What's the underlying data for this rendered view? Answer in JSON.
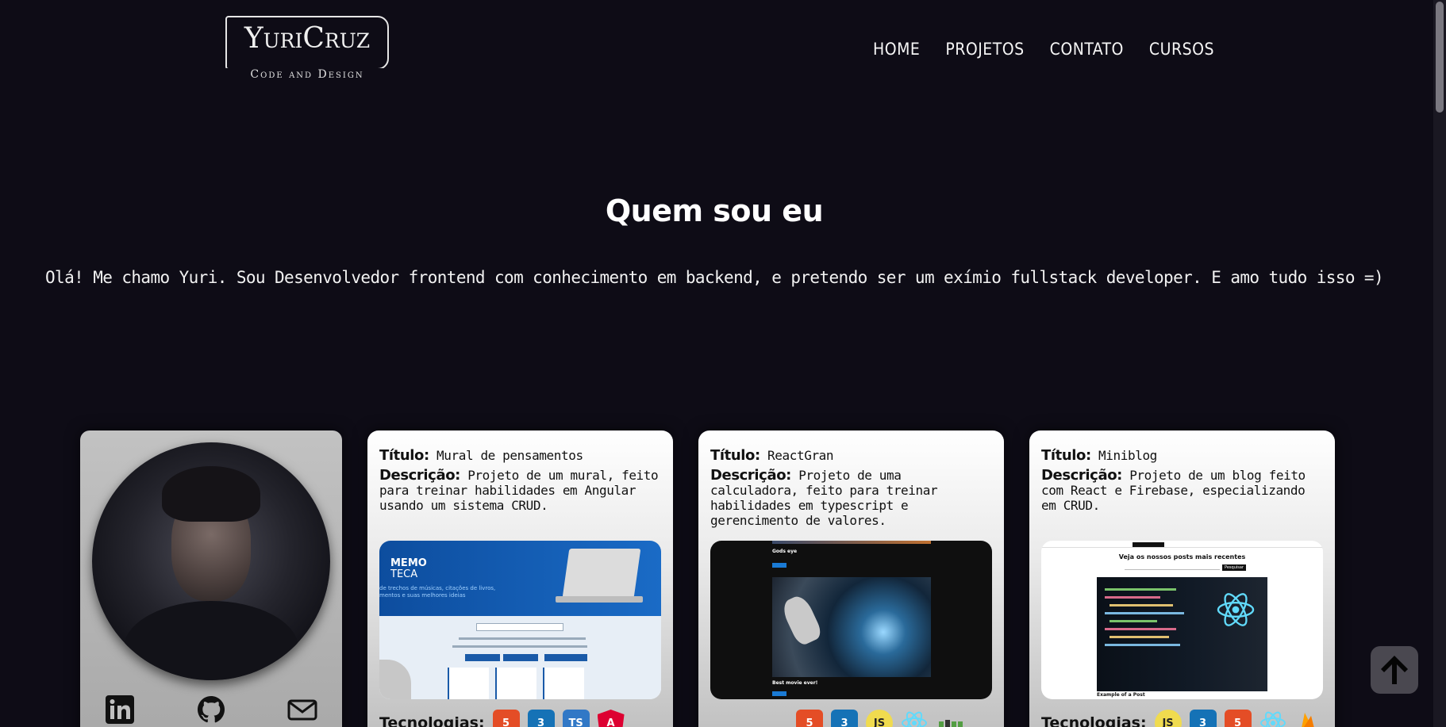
{
  "header": {
    "logo_main": "YuriCruz",
    "logo_sub": "Code and Design",
    "nav": [
      "HOME",
      "PROJETOS",
      "CONTATO",
      "CURSOS"
    ]
  },
  "hero": {
    "title": "Quem sou eu",
    "text": "Olá! Me chamo Yuri. Sou Desenvolvedor frontend com conhecimento em backend, e pretendo ser um exímio fullstack developer. E amo tudo isso =)"
  },
  "profile": {
    "social_icons": [
      "linkedin-icon",
      "github-icon",
      "mail-icon"
    ]
  },
  "labels": {
    "title": "Título:",
    "description": "Descrição:",
    "technologies": "Tecnologias:"
  },
  "projects": [
    {
      "title": "Mural de pensamentos",
      "description": "Projeto de um mural, feito para treinar habilidades em Angular usando um sistema CRUD.",
      "screenshot_text": {
        "brand_line1": "MEMO",
        "brand_line2": "TECA",
        "tagline": "de trechos de músicas, citações de livros,\nmentos e suas melhores ideias"
      },
      "technologies": [
        "HTML5",
        "CSS3",
        "TS",
        "Angular"
      ]
    },
    {
      "title": "ReactGran",
      "description": "Projeto de uma calculadora, feito para treinar habilidades em typescript e gerencimento de valores.",
      "screenshot_text": {
        "post1": "Gods eye",
        "post2": "Best movie ever!"
      },
      "technologies": [
        "HTML5",
        "CSS3",
        "JS",
        "React",
        "Node"
      ]
    },
    {
      "title": "Miniblog",
      "description": "Projeto de um blog feito com React e Firebase, especializando em CRUD.",
      "screenshot_text": {
        "heading": "Veja os nossos posts mais recentes",
        "button": "Pesquisar",
        "caption": "Example of a Post"
      },
      "technologies": [
        "JS",
        "CSS3",
        "HTML5",
        "React",
        "Firebase"
      ]
    }
  ],
  "colors": {
    "background": "#0e0c16",
    "html5": "#e44d26",
    "css3": "#1572b6",
    "ts": "#3178c6",
    "angular": "#dd0031",
    "js": "#f0db4f",
    "react": "#61dafb",
    "firebase": "#ffa000"
  }
}
